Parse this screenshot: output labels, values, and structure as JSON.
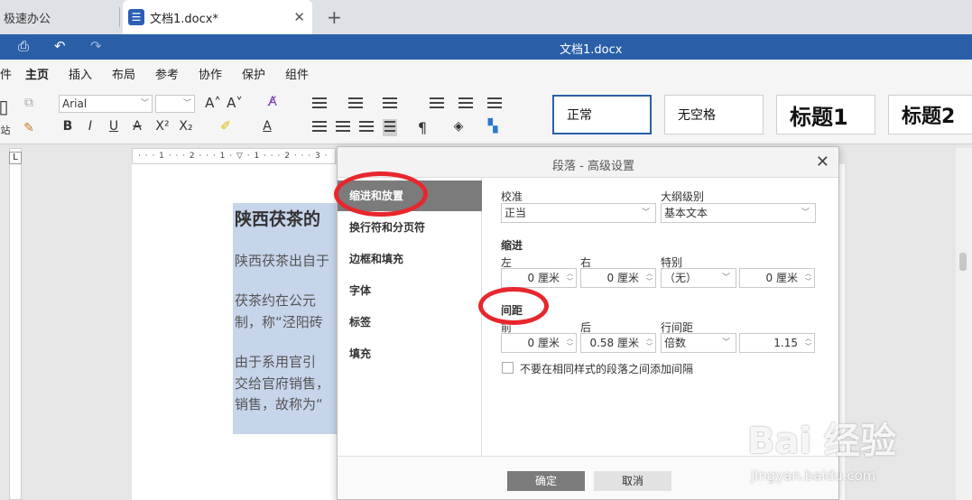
{
  "browser": {
    "tab_inactive": "极速办公",
    "tab_active": "文档1.docx*",
    "favicon": "☰",
    "close": "✕",
    "new_tab": "+"
  },
  "titlebar": {
    "doc_title": "文档1.docx"
  },
  "menu": {
    "items": [
      "件",
      "主页",
      "插入",
      "布局",
      "参考",
      "协作",
      "保护",
      "组件"
    ],
    "active_index": 1
  },
  "toolbar": {
    "font_name": "Arial",
    "font_size": "",
    "paste_label": "站",
    "styles": [
      "正常",
      "无空格",
      "标题1",
      "标题2"
    ]
  },
  "document": {
    "heading": "陕西茯茶的",
    "lines": [
      "陕西茯茶出自于",
      "茯茶约在公元",
      "制，称“泾阳砖",
      "由于系用官引",
      "交给官府销售，",
      "销售，故称为“"
    ]
  },
  "dialog": {
    "title": "段落 - 高级设置",
    "close": "✕",
    "nav": [
      "缩进和放置",
      "换行符和分页符",
      "边框和填充",
      "字体",
      "标签",
      "填充"
    ],
    "active_nav": 0,
    "alignment": {
      "label": "校准",
      "value": "正当"
    },
    "outline": {
      "label": "大纲级别",
      "value": "基本文本"
    },
    "indent": {
      "section": "缩进",
      "left_label": "左",
      "left_value": "0 厘米",
      "right_label": "右",
      "right_value": "0 厘米",
      "special_label": "特别",
      "special_value": "（无）",
      "special_amount": "0 厘米"
    },
    "spacing": {
      "section": "间距",
      "before_label": "前",
      "before_value": "0 厘米",
      "after_label": "后",
      "after_value": "0.58 厘米",
      "line_label": "行间距",
      "line_type": "倍数",
      "line_value": "1.15"
    },
    "checkbox_label": "不要在相同样式的段落之间添加间隔",
    "ok": "确定",
    "cancel": "取消"
  },
  "watermark": {
    "big": "Bai 经验",
    "small": "jingyan.baidu.com"
  },
  "annotation_color": "#e8262d"
}
